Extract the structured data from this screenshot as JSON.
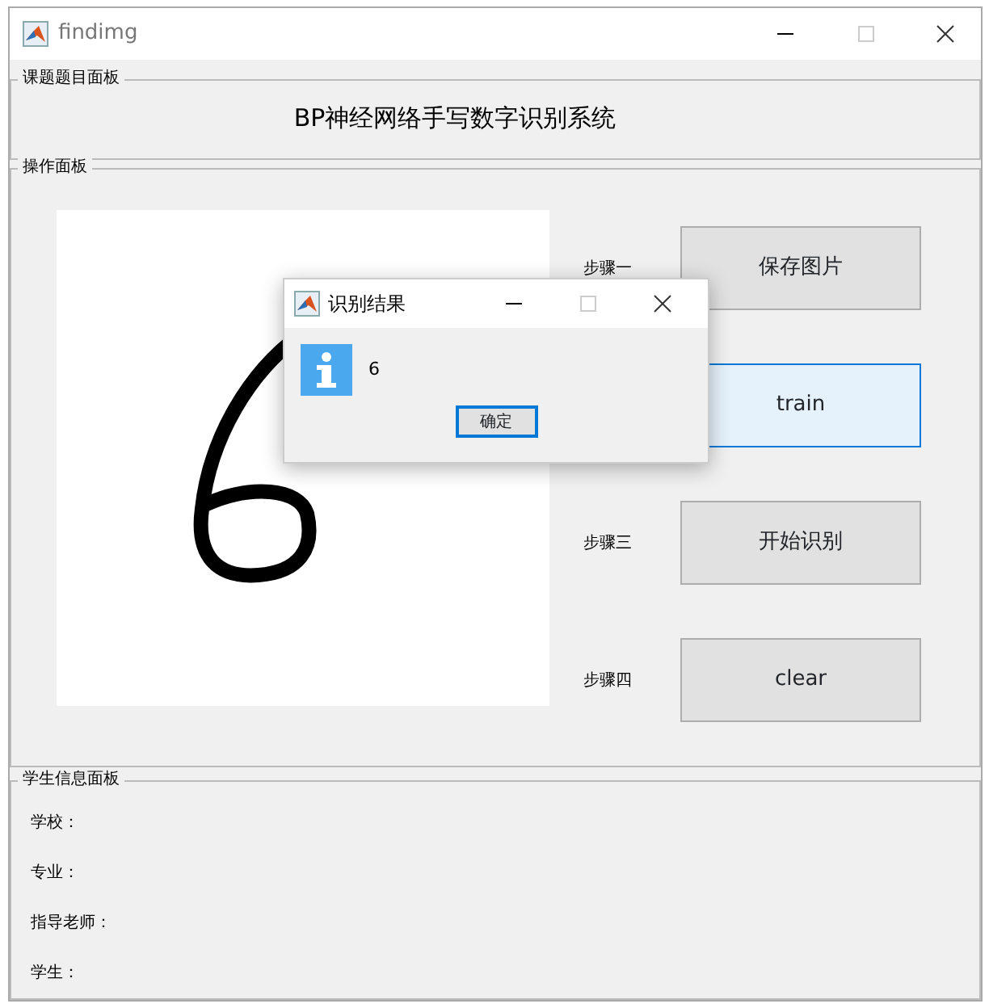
{
  "window": {
    "title": "findimg"
  },
  "title_panel": {
    "legend": "课题题目面板",
    "heading": "BP神经网络手写数字识别系统"
  },
  "operation_panel": {
    "legend": "操作面板",
    "steps": [
      {
        "label": "步骤一",
        "button": "保存图片",
        "focused": false
      },
      {
        "button": "train",
        "focused": true
      },
      {
        "label": "步骤三",
        "button": "开始识别",
        "focused": false
      },
      {
        "label": "步骤四",
        "button": "clear",
        "focused": false
      }
    ]
  },
  "student_panel": {
    "legend": "学生信息面板",
    "fields": [
      "学校：",
      "专业：",
      "指导老师：",
      "学生："
    ]
  },
  "dialog": {
    "title": "识别结果",
    "message": "6",
    "button": "确定"
  }
}
